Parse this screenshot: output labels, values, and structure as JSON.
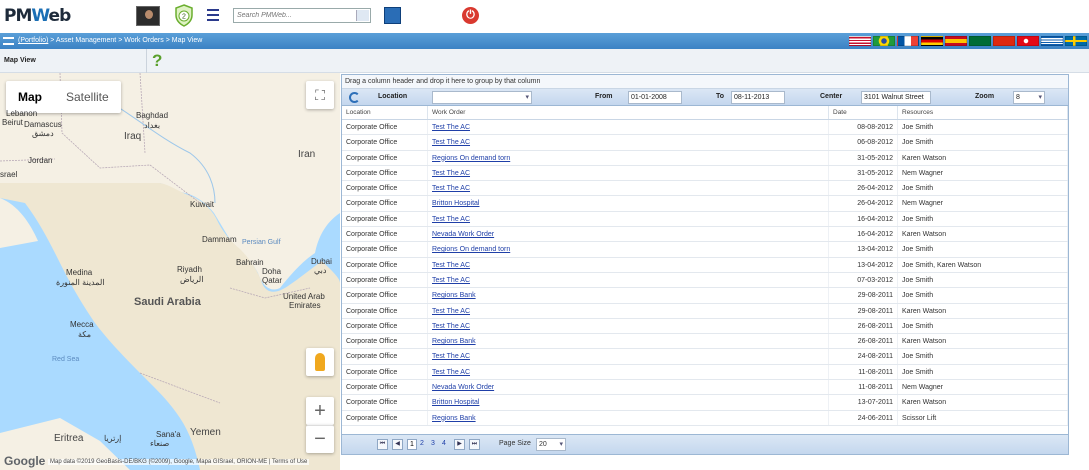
{
  "app": {
    "logo": "PMWeb",
    "notification_count": "2",
    "search_placeholder": "Search PMWeb..."
  },
  "breadcrumb": {
    "root": "(Portfolio)",
    "rest": " > Asset Management > Work Orders > Map View"
  },
  "page": {
    "title": "Map View",
    "help": "?"
  },
  "map": {
    "type_buttons": [
      "Map",
      "Satellite"
    ],
    "labels": {
      "lebanon": "Lebanon",
      "beirut": "Beirut",
      "damascus": "Damascus",
      "damascus_ar": "دمشق",
      "baghdad": "Baghdad",
      "baghdad_ar": "بغداد",
      "iraq": "Iraq",
      "jordan": "Jordan",
      "israel": "srael",
      "iran": "Iran",
      "kuwait": "Kuwait",
      "dammam": "Dammam",
      "persian_gulf": "Persian Gulf",
      "bahrain": "Bahrain",
      "doha": "Doha",
      "qatar": "Qatar",
      "dubai": "Dubai",
      "dubai_ar": "دبي",
      "uae": "United Arab",
      "uae2": "Emirates",
      "medina": "Medina",
      "medina_ar": "المدينة المنورة",
      "riyadh": "Riyadh",
      "riyadh_ar": "الرياض",
      "saudi": "Saudi Arabia",
      "mecca": "Mecca",
      "mecca_ar": "مكة",
      "redsea": "Red Sea",
      "eritrea": "Eritrea",
      "asmara": "إرتريا",
      "sanaa": "Sana'a",
      "sanaa_ar": "صنعاء",
      "yemen": "Yemen"
    },
    "attribution": "Map data ©2019 GeoBasis-DE/BKG (©2009), Google, Mapa GISrael, ORION-ME  |  Terms of Use",
    "google": "Google",
    "colors": {
      "water": "#aadaff",
      "land": "#f5f0e4",
      "desert": "#efe7d2"
    }
  },
  "grid": {
    "group_hint": "Drag a column header and drop it here to group by that column",
    "filters": {
      "location_label": "Location",
      "location_value": "",
      "from_label": "From",
      "from_value": "01-01-2008",
      "to_label": "To",
      "to_value": "08-11-2013",
      "center_label": "Center",
      "center_value": "3101 Walnut Street",
      "zoom_label": "Zoom",
      "zoom_value": "8"
    },
    "columns": [
      "Location",
      "Work Order",
      "Date",
      "Resources"
    ],
    "rows": [
      [
        "Corporate Office",
        "Test The AC",
        "08-08-2012",
        "Joe Smith"
      ],
      [
        "Corporate Office",
        "Test The AC",
        "06-08-2012",
        "Joe Smith"
      ],
      [
        "Corporate Office",
        "Regions On demand torn",
        "31-05-2012",
        "Karen Watson"
      ],
      [
        "Corporate Office",
        "Test The AC",
        "31-05-2012",
        "Nem Wagner"
      ],
      [
        "Corporate Office",
        "Test The AC",
        "26-04-2012",
        "Joe Smith"
      ],
      [
        "Corporate Office",
        "Britton Hospital",
        "26-04-2012",
        "Nem Wagner"
      ],
      [
        "Corporate Office",
        "Test The AC",
        "16-04-2012",
        "Joe Smith"
      ],
      [
        "Corporate Office",
        "Nevada Work Order",
        "16-04-2012",
        "Karen Watson"
      ],
      [
        "Corporate Office",
        "Regions On demand torn",
        "13-04-2012",
        "Joe Smith"
      ],
      [
        "Corporate Office",
        "Test The AC",
        "13-04-2012",
        "Joe Smith, Karen Watson"
      ],
      [
        "Corporate Office",
        "Test The AC",
        "07-03-2012",
        "Joe Smith"
      ],
      [
        "Corporate Office",
        "Regions Bank",
        "29-08-2011",
        "Joe Smith"
      ],
      [
        "Corporate Office",
        "Test The AC",
        "29-08-2011",
        "Karen Watson"
      ],
      [
        "Corporate Office",
        "Test The AC",
        "26-08-2011",
        "Joe Smith"
      ],
      [
        "Corporate Office",
        "Regions Bank",
        "26-08-2011",
        "Karen Watson"
      ],
      [
        "Corporate Office",
        "Test The AC",
        "24-08-2011",
        "Joe Smith"
      ],
      [
        "Corporate Office",
        "Test The AC",
        "11-08-2011",
        "Joe Smith"
      ],
      [
        "Corporate Office",
        "Nevada Work Order",
        "11-08-2011",
        "Nem Wagner"
      ],
      [
        "Corporate Office",
        "Britton Hospital",
        "13-07-2011",
        "Karen Watson"
      ],
      [
        "Corporate Office",
        "Regions Bank",
        "24-06-2011",
        "Scissor Lift"
      ]
    ],
    "pager": {
      "pages": [
        "1",
        "2",
        "3",
        "4"
      ],
      "current": "1",
      "page_size_label": "Page Size",
      "page_size": "20"
    }
  }
}
